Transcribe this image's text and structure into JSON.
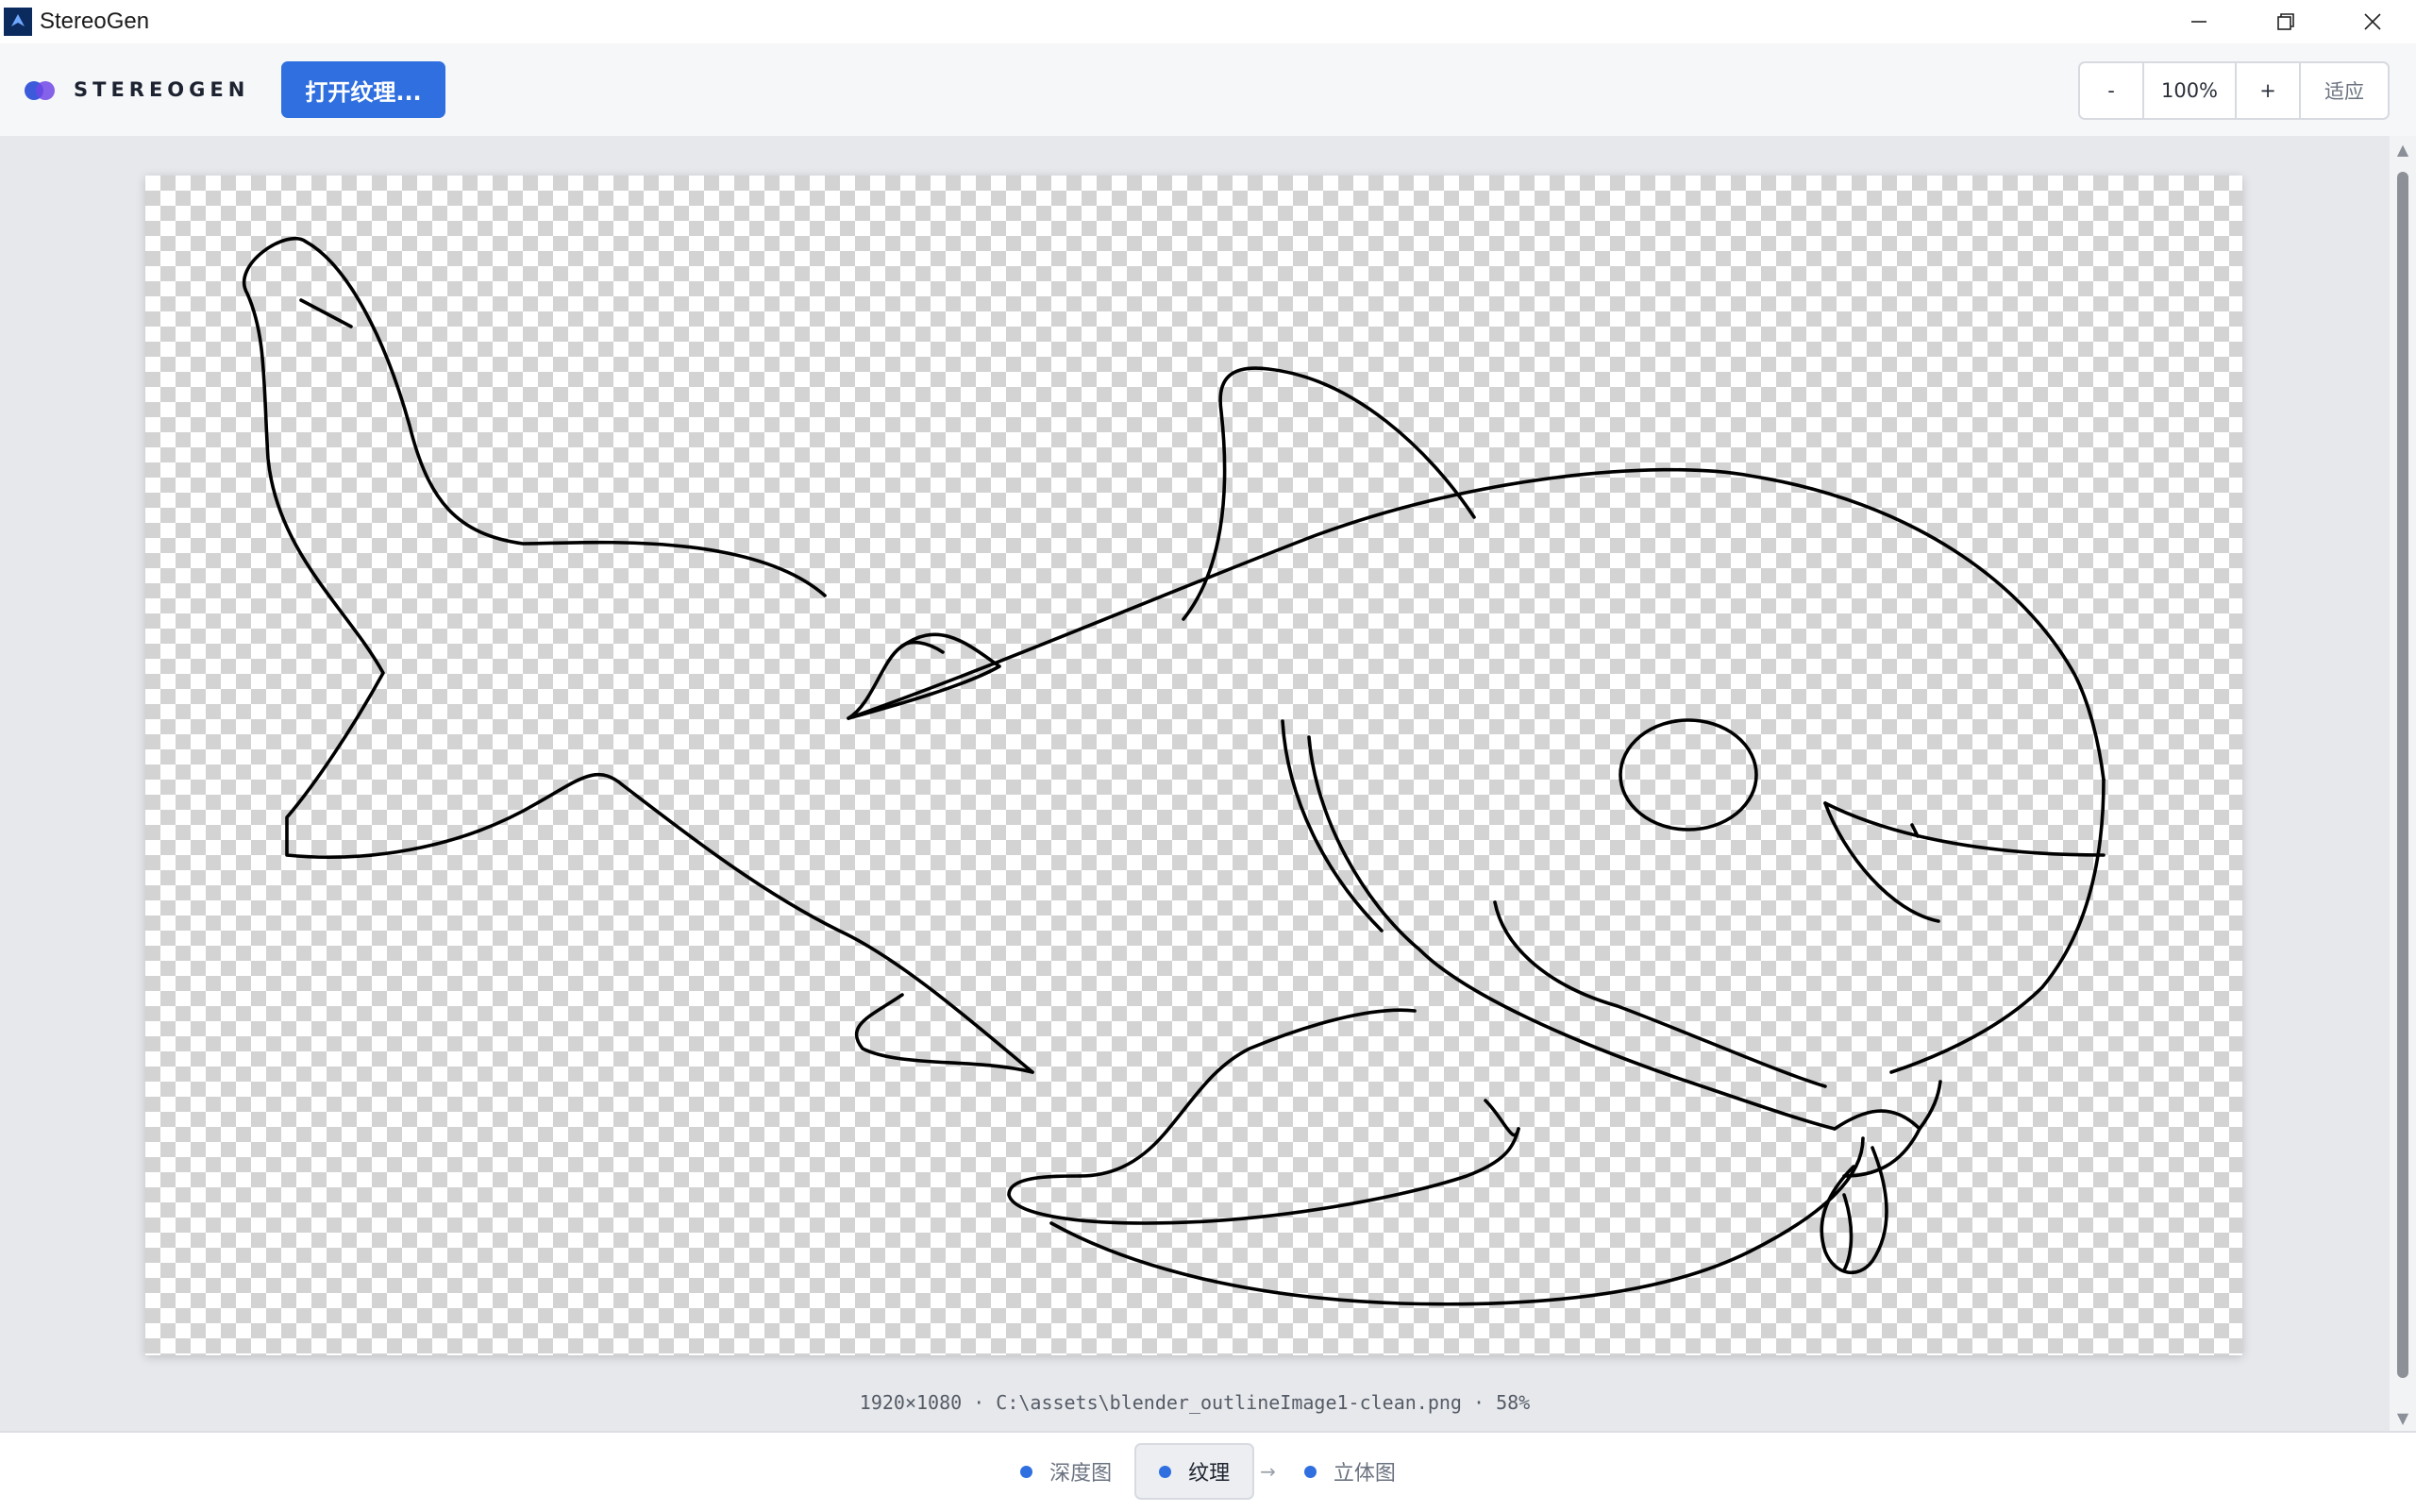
{
  "window": {
    "title": "StereoGen"
  },
  "toolbar": {
    "brand": "STEREOGEN",
    "open_button": "打开纹理...",
    "zoom_out": "-",
    "zoom_level": "100%",
    "zoom_in": "+",
    "fit": "适应"
  },
  "canvas": {
    "file_info": "1920×1080 · C:\\assets\\blender_outlineImage1-clean.png · 58%"
  },
  "steps": {
    "items": [
      {
        "label": "深度图"
      },
      {
        "label": "纹理"
      },
      {
        "label": "立体图"
      }
    ],
    "active_index": 1,
    "arrow": "→"
  },
  "colors": {
    "accent": "#2f6fe0",
    "brand_dot_1": "#3b5bdb",
    "brand_dot_2": "#7048e8"
  }
}
